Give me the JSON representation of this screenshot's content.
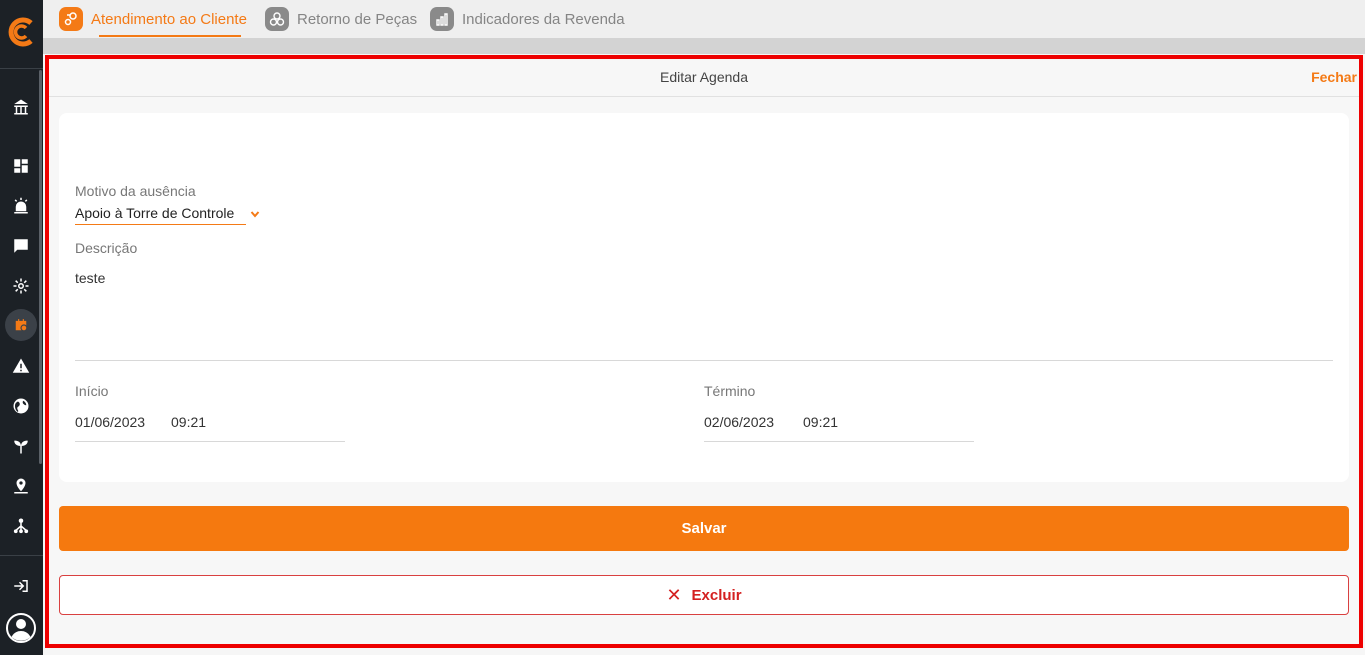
{
  "tabs": [
    {
      "label": "Atendimento ao Cliente",
      "icon": "customer-service-icon",
      "active": true
    },
    {
      "label": "Retorno de Peças",
      "icon": "parts-return-icon",
      "active": false
    },
    {
      "label": "Indicadores da Revenda",
      "icon": "bar-chart-icon",
      "active": false
    }
  ],
  "panel": {
    "title": "Editar Agenda",
    "close_label": "Fechar"
  },
  "form": {
    "reason_label": "Motivo da ausência",
    "reason_value": "Apoio à Torre de Controle",
    "description_label": "Descrição",
    "description_value": "teste",
    "start_label": "Início",
    "start_date": "01/06/2023",
    "start_time": "09:21",
    "end_label": "Término",
    "end_date": "02/06/2023",
    "end_time": "09:21"
  },
  "actions": {
    "save_label": "Salvar",
    "delete_label": "Excluir"
  },
  "colors": {
    "accent": "#f47a16",
    "sidebar": "#1c2126",
    "danger": "#d42020",
    "highlight_frame": "#ee0000"
  }
}
